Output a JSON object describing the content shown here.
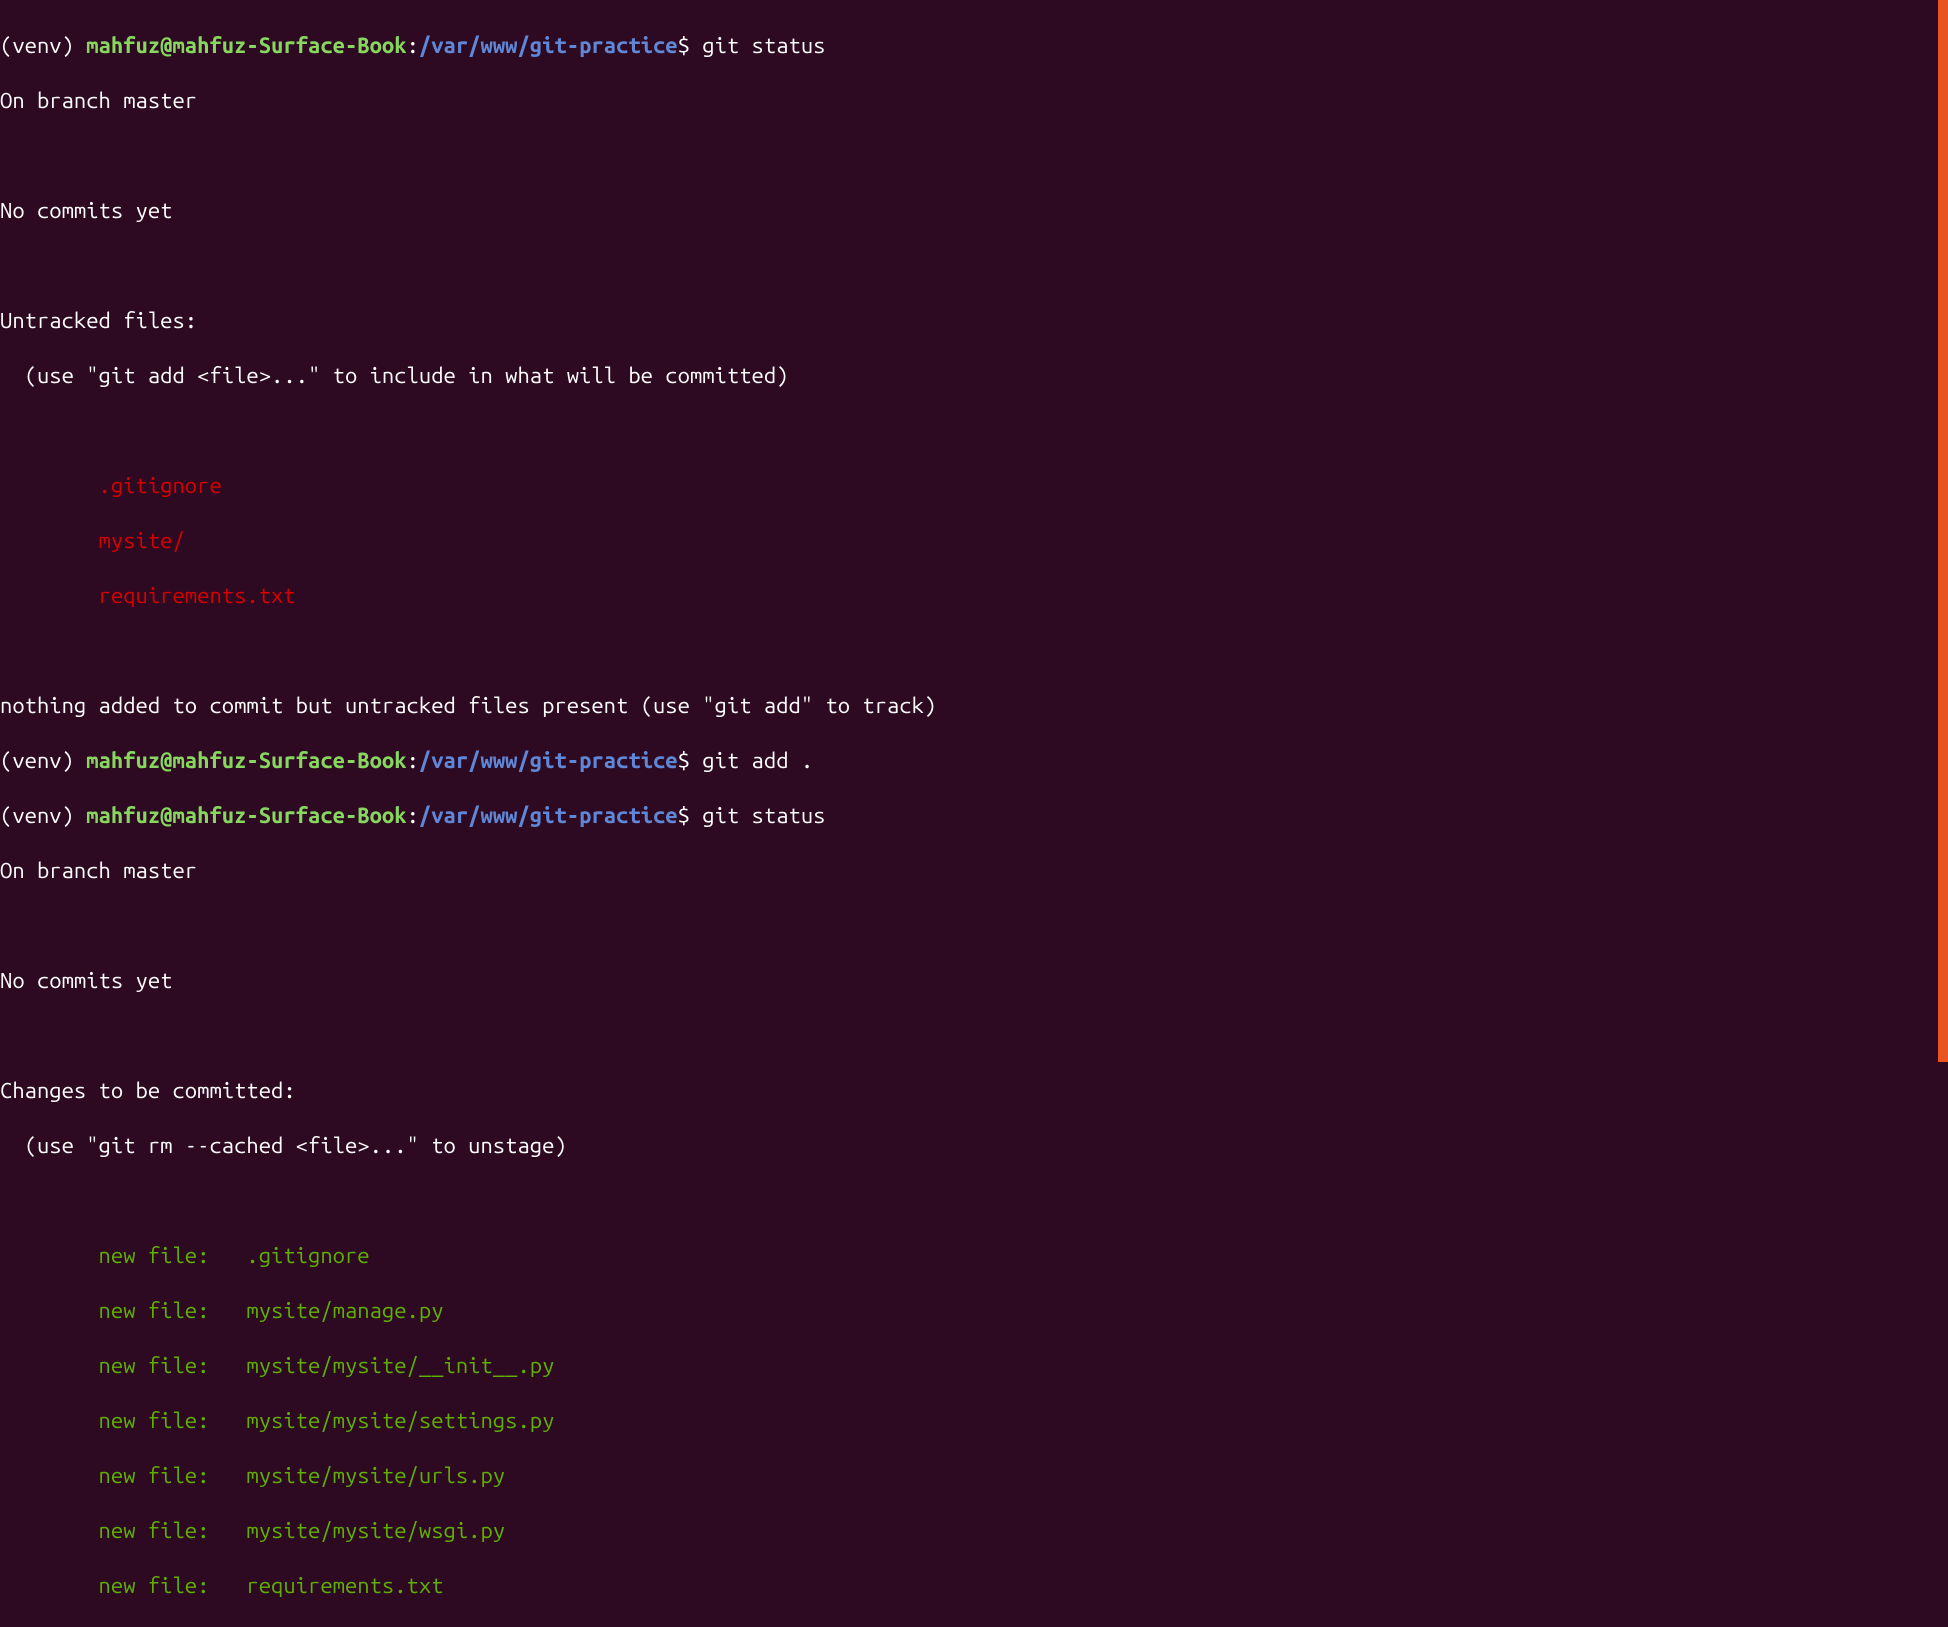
{
  "prompts": {
    "venv": "(venv) ",
    "user_host": "mahfuz@mahfuz-Surface-Book",
    "colon": ":",
    "path": "/var/www/git-practice",
    "dollar": "$ "
  },
  "commands": {
    "cmd1": "git status",
    "cmd2": "git add .",
    "cmd3": "git status"
  },
  "output1": {
    "branch": "On branch master",
    "blank1": "",
    "no_commits": "No commits yet",
    "blank2": "",
    "untracked_header": "Untracked files:",
    "untracked_hint": "  (use \"git add <file>...\" to include in what will be committed)",
    "blank3": "",
    "file1": "        .gitignore",
    "file2": "        mysite/",
    "file3": "        requirements.txt",
    "blank4": "",
    "nothing_added": "nothing added to commit but untracked files present (use \"git add\" to track)"
  },
  "output2": {
    "branch": "On branch master",
    "blank1": "",
    "no_commits": "No commits yet",
    "blank2": "",
    "changes_header": "Changes to be committed:",
    "changes_hint": "  (use \"git rm --cached <file>...\" to unstage)",
    "blank3": "",
    "file1": "        new file:   .gitignore",
    "file2": "        new file:   mysite/manage.py",
    "file3": "        new file:   mysite/mysite/__init__.py",
    "file4": "        new file:   mysite/mysite/settings.py",
    "file5": "        new file:   mysite/mysite/urls.py",
    "file6": "        new file:   mysite/mysite/wsgi.py",
    "file7": "        new file:   requirements.txt"
  }
}
